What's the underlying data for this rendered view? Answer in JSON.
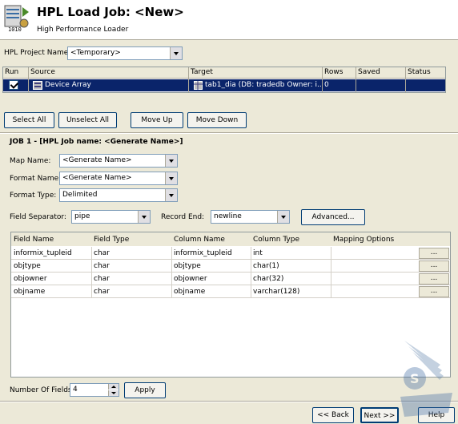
{
  "header": {
    "title": "HPL Load Job: <New>",
    "subtitle": "High Performance Loader",
    "icon": "load-job-icon"
  },
  "project": {
    "label": "HPL Project Name:",
    "value": "<Temporary>"
  },
  "job_grid": {
    "columns": [
      "Run",
      "Source",
      "Target",
      "Rows",
      "Saved",
      "Status"
    ],
    "row": {
      "checked": true,
      "source": "Device Array",
      "target": "tab1_dia (DB: tradedb  Owner: i...",
      "rows": "0",
      "saved": "",
      "status": ""
    }
  },
  "buttons": {
    "select_all": "Select All",
    "unselect_all": "Unselect All",
    "move_up": "Move Up",
    "move_down": "Move Down",
    "advanced": "Advanced...",
    "apply": "Apply",
    "back": "<< Back",
    "next": "Next >>",
    "help": "Help"
  },
  "job": {
    "heading": "JOB 1 - [HPL Job name: <Generate Name>]",
    "map_label": "Map Name:",
    "map_value": "<Generate Name>",
    "format_label": "Format Name:",
    "format_value": "<Generate Name>",
    "format_type_label": "Format Type:",
    "format_type_value": "Delimited",
    "field_sep_label": "Field Separator:",
    "field_sep_value": "pipe",
    "record_end_label": "Record End:",
    "record_end_value": "newline"
  },
  "fields": {
    "columns": [
      "Field Name",
      "Field Type",
      "Column Name",
      "Column Type",
      "Mapping Options"
    ],
    "rows": [
      {
        "field": "informix_tupleid",
        "type": "char",
        "column": "informix_tupleid",
        "coltype": "int",
        "btn": "..."
      },
      {
        "field": "objtype",
        "type": "char",
        "column": "objtype",
        "coltype": "char(1)",
        "btn": "..."
      },
      {
        "field": "objowner",
        "type": "char",
        "column": "objowner",
        "coltype": "char(32)",
        "btn": "..."
      },
      {
        "field": "objname",
        "type": "char",
        "column": "objname",
        "coltype": "varchar(128)",
        "btn": "..."
      }
    ]
  },
  "num_fields": {
    "label": "Number Of Fields",
    "value": "4"
  },
  "colors": {
    "selection": "#0a246a",
    "background": "#ece9d8"
  }
}
